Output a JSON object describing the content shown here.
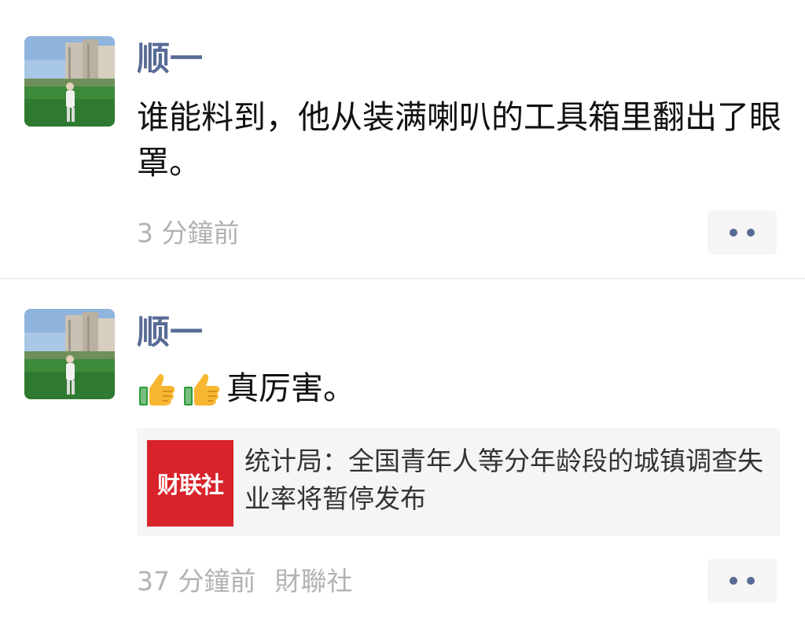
{
  "colors": {
    "author_name": "#576b95",
    "timestamp": "#b2b2b2",
    "link_card_bg": "#f5f5f5",
    "link_thumb_bg": "#d8232a"
  },
  "posts": [
    {
      "author": "顺一",
      "avatar_icon": "avatar-photo-field-buildings",
      "content": "谁能料到，他从装满喇叭的工具箱里翻出了眼罩。",
      "timestamp": "3 分鐘前",
      "more_icon": "more-dots-icon"
    },
    {
      "author": "顺一",
      "avatar_icon": "avatar-photo-field-buildings",
      "emoji": "thumbs-up-icon",
      "content": "真厉害。",
      "link": {
        "thumb_text": "财联社",
        "title": "统计局：全国青年人等分年龄段的城镇调查失业率将暂停发布"
      },
      "timestamp": "37 分鐘前",
      "source": "財聯社",
      "more_icon": "more-dots-icon"
    }
  ]
}
